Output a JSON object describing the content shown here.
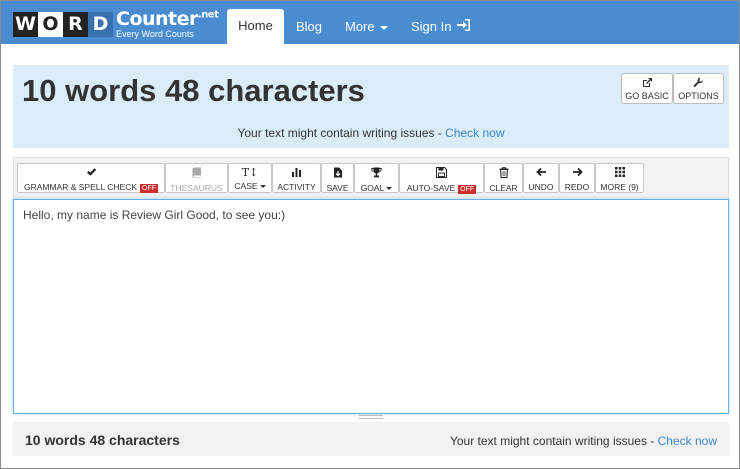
{
  "logo": {
    "letters": [
      "W",
      "O",
      "R",
      "D"
    ],
    "main": "Counter",
    "suffix": ".net",
    "tagline": "Every Word Counts"
  },
  "nav": {
    "home": "Home",
    "blog": "Blog",
    "more": "More",
    "signin": "Sign In"
  },
  "header": {
    "title": "10 words 48 characters",
    "go_basic": "GO BASIC",
    "options": "OPTIONS",
    "issue_text": "Your text might contain writing issues - ",
    "issue_link": "Check now"
  },
  "toolbar": {
    "grammar": "GRAMMAR & SPELL CHECK",
    "grammar_state": "OFF",
    "thesaurus": "THESAURUS",
    "case": "CASE",
    "activity": "ACTIVITY",
    "save": "SAVE",
    "goal": "GOAL",
    "autosave": "AUTO-SAVE",
    "autosave_state": "OFF",
    "clear": "CLEAR",
    "undo": "UNDO",
    "redo": "REDO",
    "more": "MORE (9)"
  },
  "editor": {
    "value": "Hello, my name is Review Girl Good, to see you:)"
  },
  "footer": {
    "title": "10 words 48 characters",
    "issue_text": "Your text might contain writing issues - ",
    "issue_link": "Check now"
  },
  "colors": {
    "navbar": "#4a8cd0",
    "header_panel": "#d9ecf7",
    "link": "#3a86c8",
    "off_badge": "#c9302c"
  }
}
